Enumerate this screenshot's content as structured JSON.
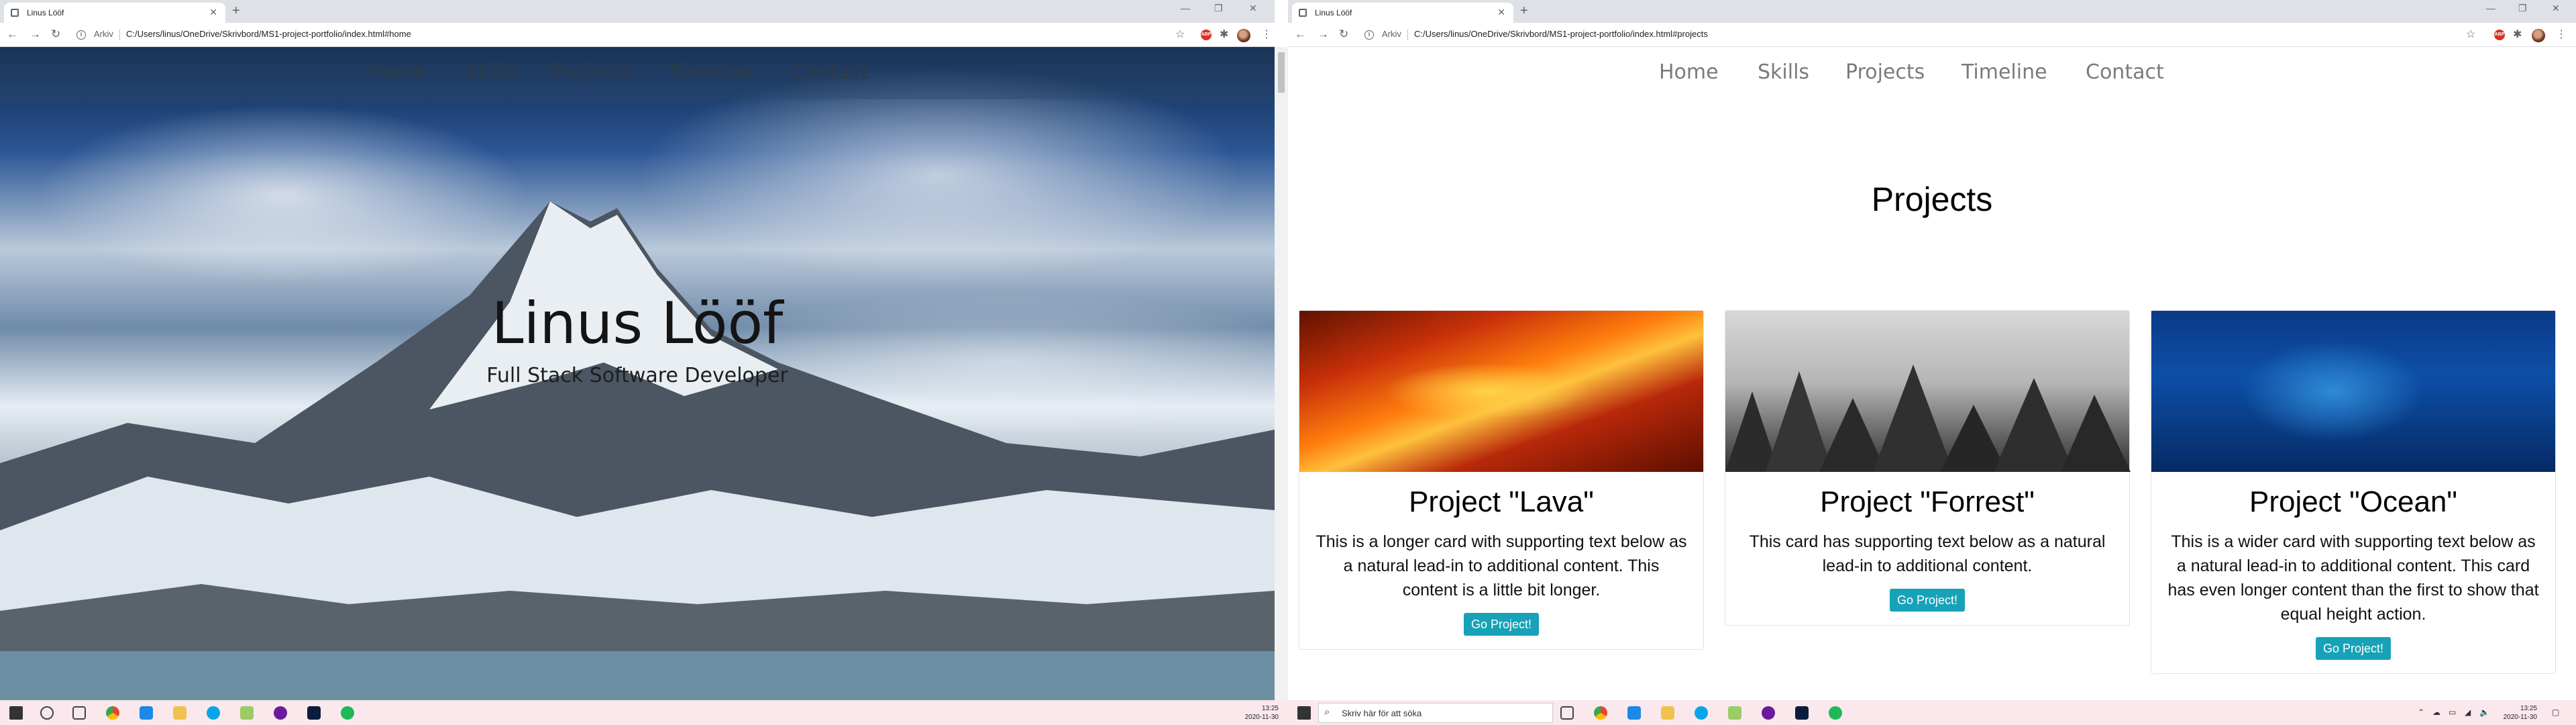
{
  "left_window": {
    "tab_title": "Linus Lööf",
    "addr_label": "Arkiv",
    "url": "C:/Users/linus/OneDrive/Skrivbord/MS1-project-portfolio/index.html#home",
    "nav": [
      "Home",
      "Skills",
      "Projects",
      "Timeline",
      "Contact"
    ],
    "hero_name": "Linus Lööf",
    "hero_subtitle": "Full Stack Software Developer"
  },
  "right_window": {
    "tab_title": "Linus Lööf",
    "addr_label": "Arkiv",
    "url": "C:/Users/linus/OneDrive/Skrivbord/MS1-project-portfolio/index.html#projects",
    "nav": [
      "Home",
      "Skills",
      "Projects",
      "Timeline",
      "Contact"
    ],
    "section_title": "Projects",
    "cards": [
      {
        "title": "Project \"Lava\"",
        "text": "This is a longer card with supporting text below as a natural lead-in to additional content. This content is a little bit longer.",
        "button": "Go Project!"
      },
      {
        "title": "Project \"Forrest\"",
        "text": "This card has supporting text below as a natural lead-in to additional content.",
        "button": "Go Project!"
      },
      {
        "title": "Project \"Ocean\"",
        "text": "This is a wider card with supporting text below as a natural lead-in to additional content. This card has even longer content than the first to show that equal height action.",
        "button": "Go Project!"
      }
    ]
  },
  "taskbar": {
    "search_placeholder": "Skriv här för att söka",
    "left_clock": {
      "time": "13:25",
      "date": "2020-11-30"
    },
    "right_clock": {
      "time": "13:25",
      "date": "2020-11-30"
    }
  },
  "colors": {
    "button": "#17a2b8",
    "taskbar": "#fbe8ed",
    "tabstrip": "#dee1e6"
  },
  "icons": [
    "back-icon",
    "forward-icon",
    "reload-icon",
    "info-icon",
    "star-icon",
    "adblock-icon",
    "puzzle-icon",
    "menu-icon",
    "search-icon",
    "windows-start-icon"
  ]
}
